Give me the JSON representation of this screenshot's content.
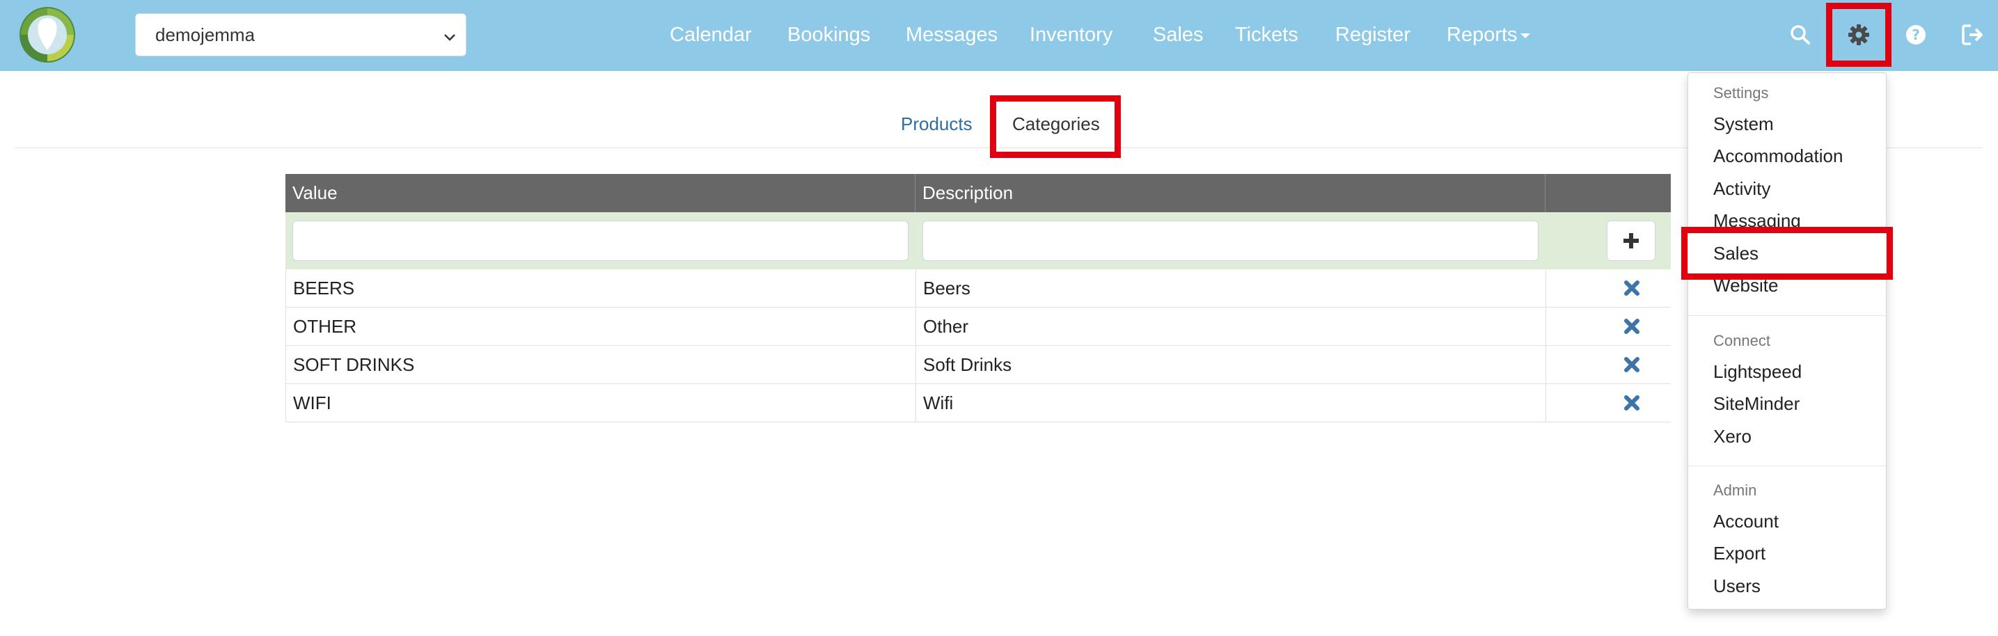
{
  "colors": {
    "navbar": "#8ecae8",
    "table_header": "#676767",
    "filter_row": "#dfedd8",
    "link": "#2e6da4",
    "highlight": "#e0000f",
    "delete_icon": "#3d74a8"
  },
  "header": {
    "property_select": {
      "value": "demojemma"
    },
    "nav": [
      {
        "label": "Calendar"
      },
      {
        "label": "Bookings"
      },
      {
        "label": "Messages"
      },
      {
        "label": "Inventory"
      },
      {
        "label": "Sales"
      },
      {
        "label": "Tickets"
      },
      {
        "label": "Register"
      },
      {
        "label": "Reports"
      }
    ],
    "icons": [
      "search-icon",
      "gear-icon",
      "help-icon",
      "logout-icon"
    ]
  },
  "tabs": [
    {
      "label": "Products"
    },
    {
      "label": "Categories"
    }
  ],
  "table": {
    "columns": [
      "Value",
      "Description",
      ""
    ],
    "rows": [
      {
        "value": "BEERS",
        "description": "Beers"
      },
      {
        "value": "OTHER",
        "description": "Other"
      },
      {
        "value": "SOFT DRINKS",
        "description": "Soft Drinks"
      },
      {
        "value": "WIFI",
        "description": "Wifi"
      }
    ]
  },
  "settings_menu": {
    "sections": [
      {
        "header": "Settings",
        "items": [
          "System",
          "Accommodation",
          "Activity",
          "Messaging",
          "Sales",
          "Website"
        ]
      },
      {
        "header": "Connect",
        "items": [
          "Lightspeed",
          "SiteMinder",
          "Xero"
        ]
      },
      {
        "header": "Admin",
        "items": [
          "Account",
          "Export",
          "Users"
        ]
      }
    ]
  }
}
